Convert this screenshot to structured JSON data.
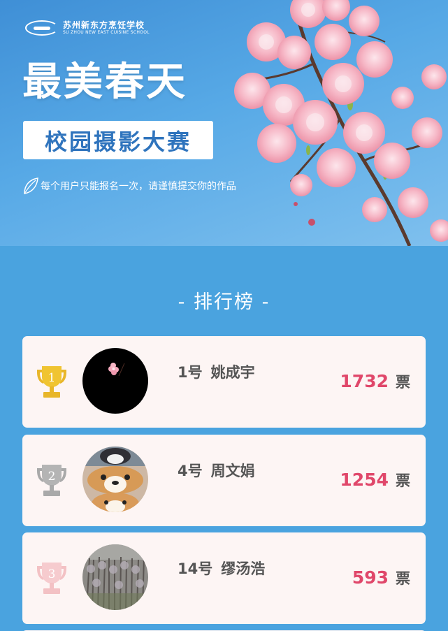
{
  "banner": {
    "school_name_cn": "苏州新东方烹饪学校",
    "school_name_en": "SU ZHOU NEW EAST CUISINE SCHOOL",
    "title": "最美春天",
    "subtitle": "校园摄影大赛",
    "notice": "每个用户只能报名一次，请谨慎提交你的作品"
  },
  "ranking": {
    "title": "- 排行榜 -",
    "vote_unit": "票",
    "entries": [
      {
        "rank": "1",
        "number": "1号",
        "name": "姚成宇",
        "votes": "1732",
        "trophy_color": "#e8b62a",
        "avatar": "black-with-flower"
      },
      {
        "rank": "2",
        "number": "4号",
        "name": "周文娟",
        "votes": "1254",
        "trophy_color": "#a9a9a9",
        "avatar": "corgi-dogs"
      },
      {
        "rank": "3",
        "number": "14号",
        "name": "缪汤浩",
        "votes": "593",
        "trophy_color": "#f3c1c4",
        "avatar": "lavender-field"
      }
    ]
  },
  "colors": {
    "background": "#4aa3df",
    "card": "#fdf5f4",
    "vote_number": "#e0476a",
    "subtitle": "#2f74bd"
  }
}
